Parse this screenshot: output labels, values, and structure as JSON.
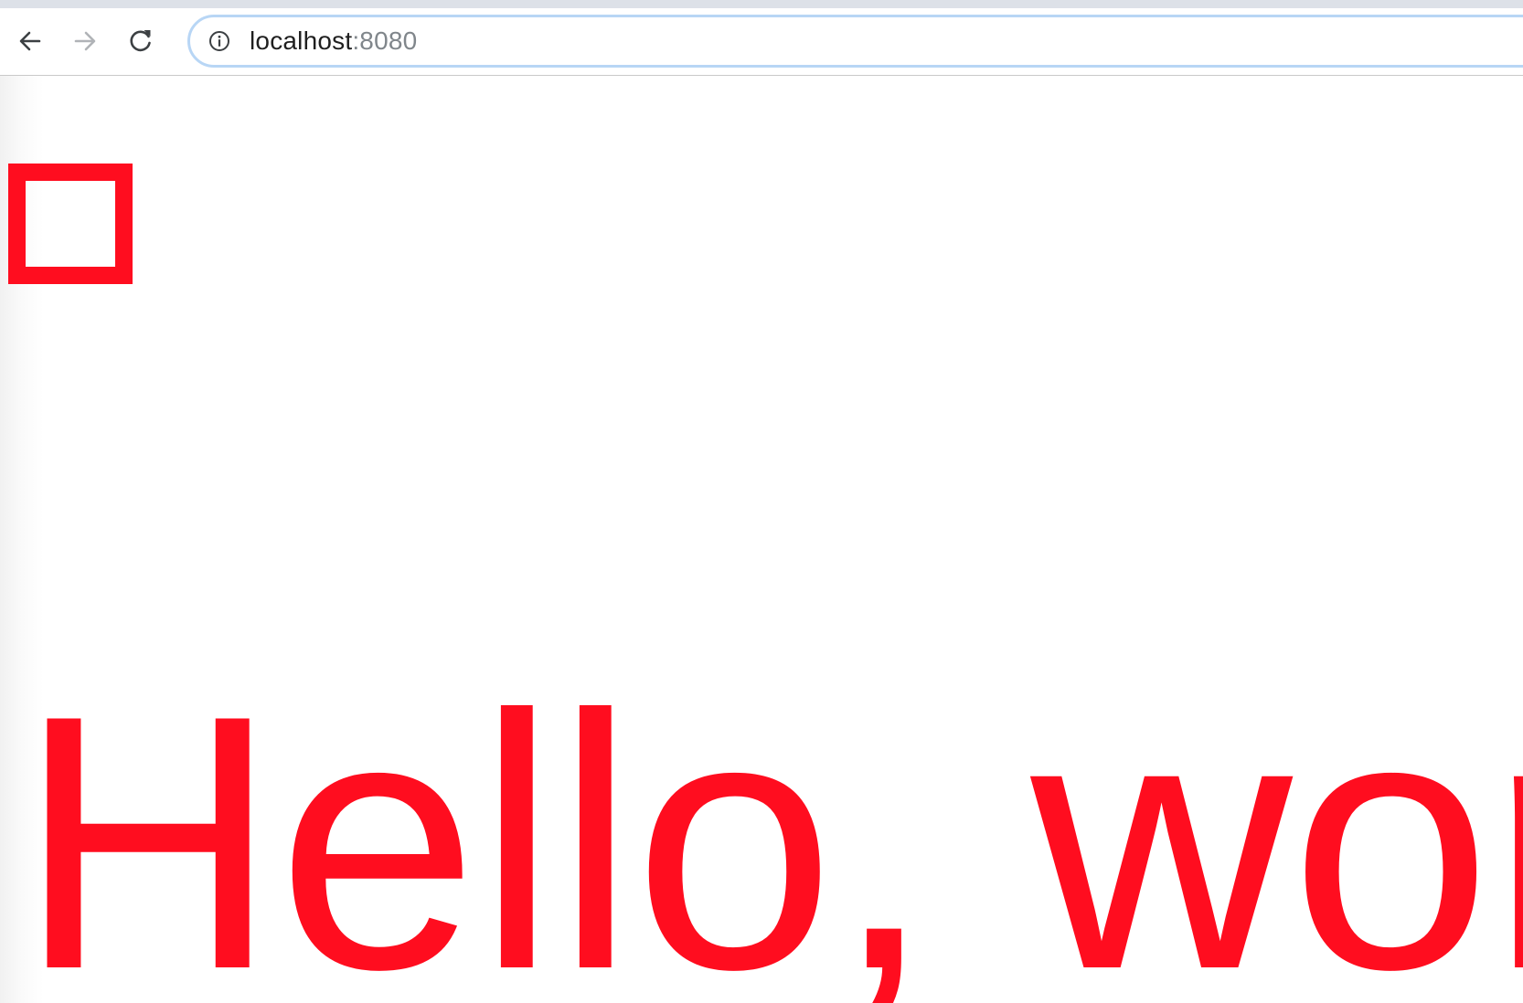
{
  "browser": {
    "address_bar": {
      "host": "localhost",
      "port": ":8080"
    },
    "icons": {
      "back": "back-arrow-icon",
      "forward": "forward-arrow-icon",
      "reload": "reload-icon",
      "site_info": "info-icon"
    }
  },
  "page": {
    "heading": "Hello, world",
    "colors": {
      "accent": "#ff0d1f",
      "omnibox_border": "#b8d6f5"
    }
  }
}
